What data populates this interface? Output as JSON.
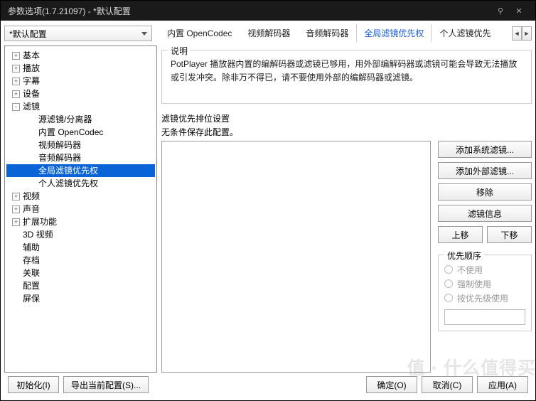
{
  "window": {
    "title": "参数选项(1.7.21097) - *默认配置",
    "pin_icon": "⚲",
    "close_icon": "✕"
  },
  "profile": {
    "selected": "*默认配置"
  },
  "tabs": {
    "items": [
      {
        "label": "内置 OpenCodec"
      },
      {
        "label": "视频解码器"
      },
      {
        "label": "音频解码器"
      },
      {
        "label": "全局滤镜优先权"
      },
      {
        "label": "个人滤镜优先"
      }
    ],
    "left_arrow": "◄",
    "right_arrow": "►"
  },
  "tree": {
    "items": [
      {
        "label": "基本",
        "indent": 1,
        "exp": "+"
      },
      {
        "label": "播放",
        "indent": 1,
        "exp": "+"
      },
      {
        "label": "字幕",
        "indent": 1,
        "exp": "+"
      },
      {
        "label": "设备",
        "indent": 1,
        "exp": "+"
      },
      {
        "label": "滤镜",
        "indent": 1,
        "exp": "-"
      },
      {
        "label": "源滤镜/分离器",
        "indent": 2,
        "exp": ""
      },
      {
        "label": "内置 OpenCodec",
        "indent": 2,
        "exp": ""
      },
      {
        "label": "视频解码器",
        "indent": 2,
        "exp": ""
      },
      {
        "label": "音频解码器",
        "indent": 2,
        "exp": ""
      },
      {
        "label": "全局滤镜优先权",
        "indent": 2,
        "exp": "",
        "sel": true
      },
      {
        "label": "个人滤镜优先权",
        "indent": 2,
        "exp": ""
      },
      {
        "label": "视频",
        "indent": 1,
        "exp": "+"
      },
      {
        "label": "声音",
        "indent": 1,
        "exp": "+"
      },
      {
        "label": "扩展功能",
        "indent": 1,
        "exp": "+"
      },
      {
        "label": "3D 视频",
        "indent": 1,
        "exp": ""
      },
      {
        "label": "辅助",
        "indent": 1,
        "exp": ""
      },
      {
        "label": "存档",
        "indent": 1,
        "exp": ""
      },
      {
        "label": "关联",
        "indent": 1,
        "exp": ""
      },
      {
        "label": "配置",
        "indent": 1,
        "exp": ""
      },
      {
        "label": "屏保",
        "indent": 1,
        "exp": ""
      }
    ]
  },
  "description": {
    "title": "说明",
    "text": "PotPlayer 播放器内置的编解码器或滤镜已够用，用外部编解码器或滤镜可能会导致无法播放或引发冲突。除非万不得已，请不要使用外部的编解码器或滤镜。"
  },
  "filter": {
    "title": "滤镜优先排位设置",
    "note": "无条件保存此配置。",
    "buttons": {
      "add_sys": "添加系统滤镜...",
      "add_ext": "添加外部滤镜...",
      "remove": "移除",
      "info": "滤镜信息",
      "up": "上移",
      "down": "下移"
    }
  },
  "priority": {
    "title": "优先顺序",
    "opt_none": "不使用",
    "opt_force": "强制使用",
    "opt_rank": "按优先级使用"
  },
  "footer": {
    "init": "初始化(I)",
    "export": "导出当前配置(S)...",
    "ok": "确定(O)",
    "cancel": "取消(C)",
    "apply": "应用(A)"
  },
  "watermark": "值 · 什么值得买"
}
